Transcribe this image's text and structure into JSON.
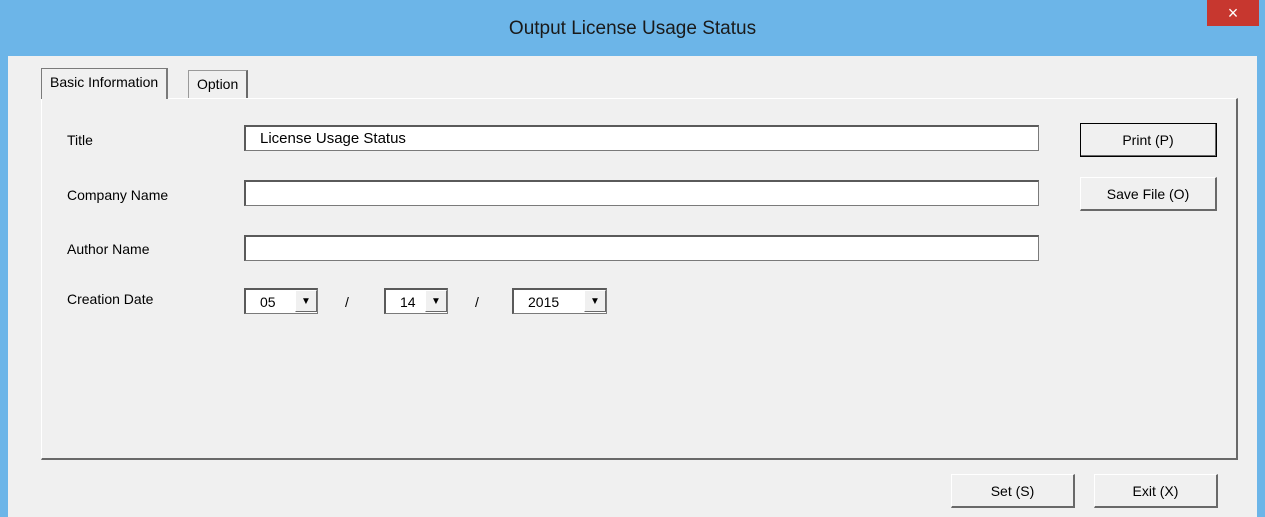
{
  "window": {
    "title": "Output License Usage Status",
    "close_label": "×"
  },
  "tabs": [
    {
      "label": "Basic Information",
      "active": true
    },
    {
      "label": "Option",
      "active": false
    }
  ],
  "form": {
    "title_label": "Title",
    "title_value": "License Usage Status",
    "company_label": "Company Name",
    "company_value": "",
    "author_label": "Author Name",
    "author_value": "",
    "date_label": "Creation Date",
    "month": "05",
    "day": "14",
    "year": "2015",
    "separator": "/",
    "dropdown_glyph": "▼"
  },
  "buttons": {
    "print": "Print (P)",
    "save_file": "Save File (O)",
    "set": "Set (S)",
    "exit": "Exit (X)"
  },
  "colors": {
    "titlebar": "#6cb5e8",
    "close": "#c7372f",
    "dialog_bg": "#f0f0f0"
  }
}
